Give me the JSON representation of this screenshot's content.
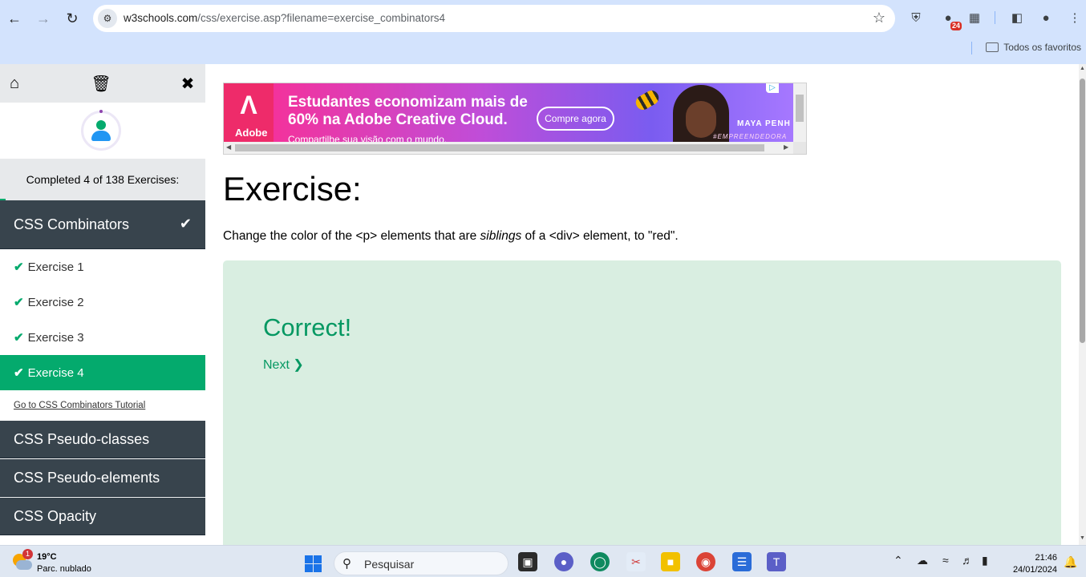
{
  "browser": {
    "url_host": "w3schools.com",
    "url_path": "/css/exercise.asp?filename=exercise_combinators4",
    "extension_badge": "24",
    "bookmarks_folder": "Todos os favoritos"
  },
  "sidebar": {
    "progress_text": "Completed 4 of 138 Exercises:",
    "progress_fraction": 0.029,
    "active_section": "CSS Combinators",
    "exercises": [
      {
        "label": "Exercise 1",
        "done": true
      },
      {
        "label": "Exercise 2",
        "done": true
      },
      {
        "label": "Exercise 3",
        "done": true
      },
      {
        "label": "Exercise 4",
        "done": true,
        "active": true
      }
    ],
    "tutorial_link": "Go to CSS Combinators Tutorial",
    "sections": [
      "CSS Pseudo-classes",
      "CSS Pseudo-elements",
      "CSS Opacity"
    ]
  },
  "ad": {
    "brand": "Adobe",
    "headline": "Estudantes economizam mais de 60% na Adobe Creative Cloud.",
    "subline": "Compartilhe sua visão com o mundo.",
    "cta": "Compre agora",
    "name": "MAYA PENH",
    "tag": "#EMPREENDEDORA"
  },
  "main": {
    "title": "Exercise:",
    "desc_before": "Change the color of the <p> elements that are ",
    "desc_em": "siblings",
    "desc_after": " of a <div> element, to \"red\".",
    "result_title": "Correct!",
    "next_label": "Next ❯"
  },
  "taskbar": {
    "weather_badge": "1",
    "weather_temp": "19°C",
    "weather_desc": "Parc. nublado",
    "search_placeholder": "Pesquisar",
    "time": "21:46",
    "date": "24/01/2024"
  },
  "colors": {
    "accent_green": "#04aa6d",
    "sidebar_dark": "#38444d",
    "result_bg": "#d9eee1",
    "chrome_bg": "#d3e3fd"
  }
}
